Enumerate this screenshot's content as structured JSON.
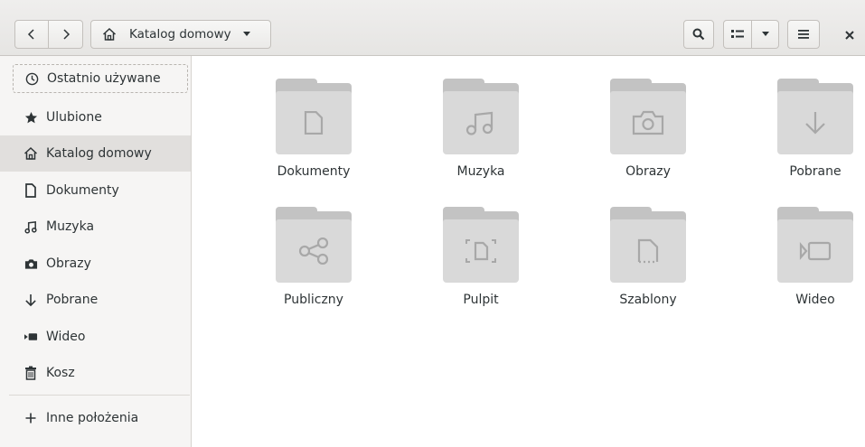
{
  "header": {
    "path_label": "Katalog domowy"
  },
  "sidebar": {
    "items": [
      {
        "label": "Ostatnio używane"
      },
      {
        "label": "Ulubione"
      },
      {
        "label": "Katalog domowy"
      },
      {
        "label": "Dokumenty"
      },
      {
        "label": "Muzyka"
      },
      {
        "label": "Obrazy"
      },
      {
        "label": "Pobrane"
      },
      {
        "label": "Wideo"
      },
      {
        "label": "Kosz"
      },
      {
        "label": "Inne położenia"
      }
    ]
  },
  "main": {
    "folders": [
      {
        "label": "Dokumenty",
        "icon": "document-icon"
      },
      {
        "label": "Muzyka",
        "icon": "music-icon"
      },
      {
        "label": "Obrazy",
        "icon": "camera-icon"
      },
      {
        "label": "Pobrane",
        "icon": "download-icon"
      },
      {
        "label": "Publiczny",
        "icon": "share-icon"
      },
      {
        "label": "Pulpit",
        "icon": "desktop-icon"
      },
      {
        "label": "Szablony",
        "icon": "template-icon"
      },
      {
        "label": "Wideo",
        "icon": "video-icon"
      }
    ]
  },
  "colors": {
    "folder_front": "#d9d9d9",
    "folder_back": "#c3c3c3",
    "folder_emblem": "#a8a8a8",
    "sidebar_active": "#e1dfdd"
  }
}
